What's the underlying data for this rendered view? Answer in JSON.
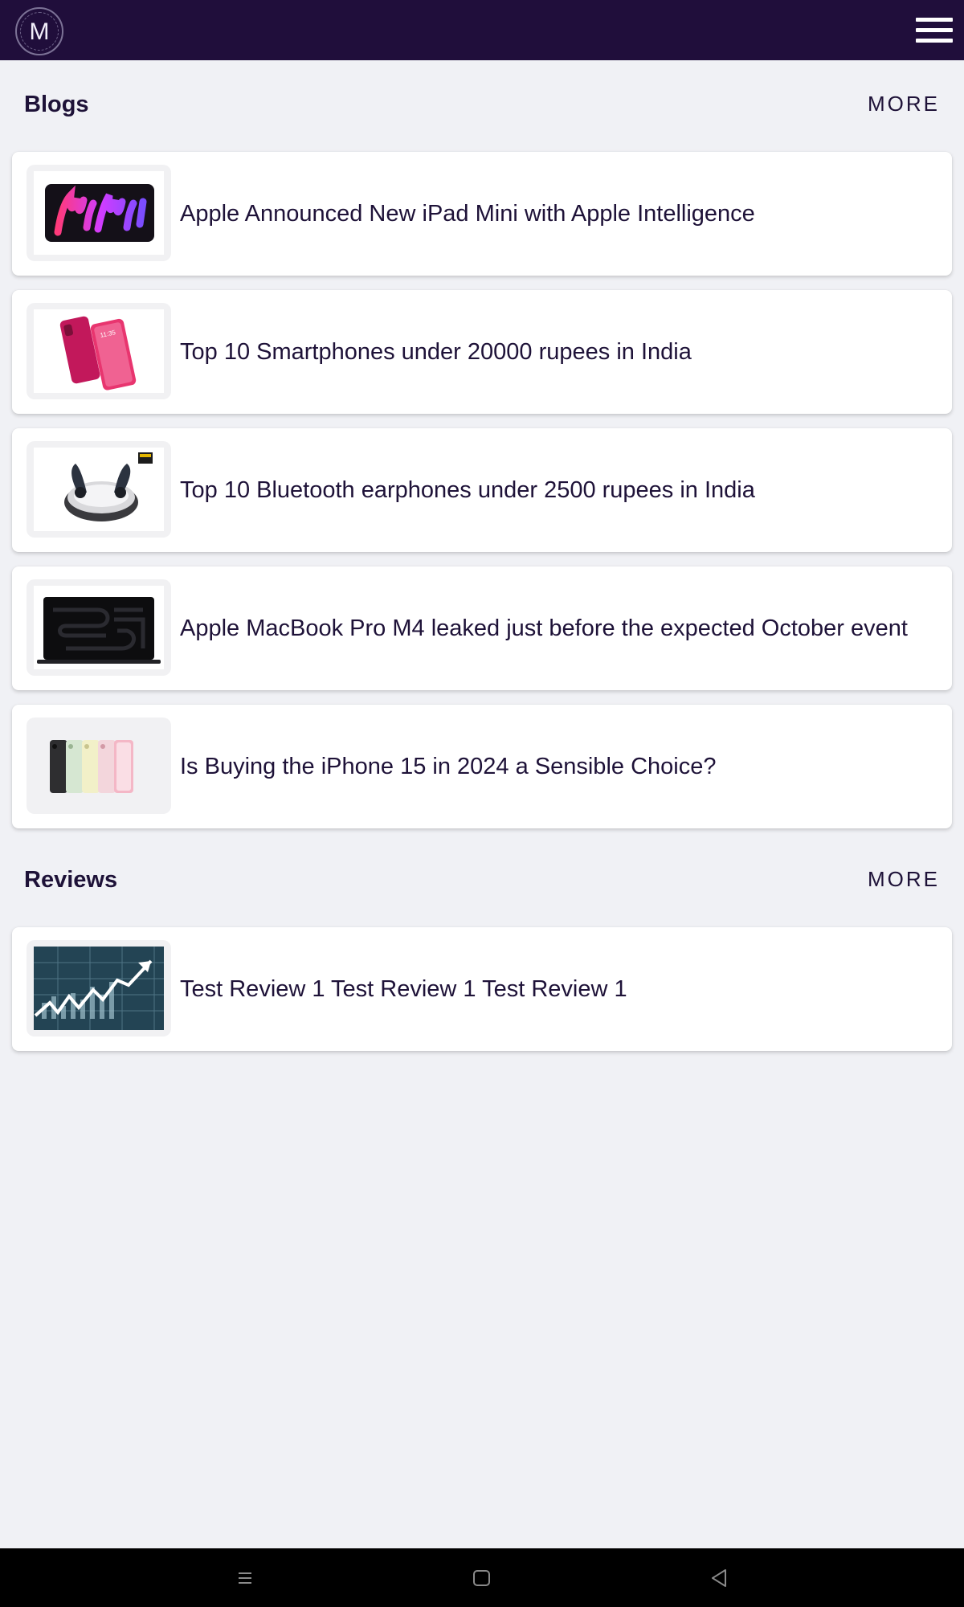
{
  "app": {
    "logo_letter": "M",
    "brand_color": "#200e3b",
    "background_color": "#f0f1f5"
  },
  "header": {
    "logo_icon": "m-logo-icon",
    "menu_icon": "hamburger-menu-icon"
  },
  "blogs": {
    "title": "Blogs",
    "more_label": "MORE",
    "items": [
      {
        "title": "Apple Announced New iPad Mini with Apple Intelligence",
        "thumbnail": "ipad-mini-icon"
      },
      {
        "title": "Top 10 Smartphones under 20000 rupees in India",
        "thumbnail": "smartphone-icon"
      },
      {
        "title": "Top 10 Bluetooth earphones under 2500 rupees in India",
        "thumbnail": "earbuds-icon"
      },
      {
        "title": "Apple MacBook Pro M4 leaked just before the expected October event",
        "thumbnail": "macbook-icon"
      },
      {
        "title": "Is Buying the iPhone 15 in 2024 a Sensible Choice?",
        "thumbnail": "iphone-lineup-icon"
      }
    ]
  },
  "reviews": {
    "title": "Reviews",
    "more_label": "MORE",
    "items": [
      {
        "title": "Test Review 1 Test Review 1 Test Review 1",
        "thumbnail": "stock-chart-icon"
      }
    ]
  },
  "system_nav": {
    "recents_icon": "recents-icon",
    "home_icon": "home-icon",
    "back_icon": "back-icon"
  }
}
